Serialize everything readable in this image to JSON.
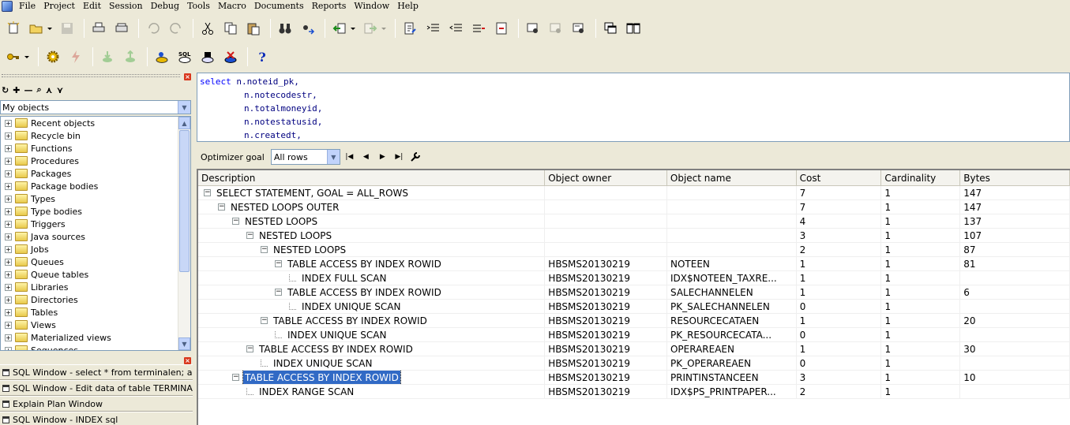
{
  "menu": [
    "File",
    "Project",
    "Edit",
    "Session",
    "Debug",
    "Tools",
    "Macro",
    "Documents",
    "Reports",
    "Window",
    "Help"
  ],
  "toolbar2": {
    "help_label": "?",
    "sql_badge": "SQL"
  },
  "left_panel": {
    "toolbar_glyphs": [
      "↻",
      "✚",
      "—",
      "⌕",
      "⋏",
      "⋎"
    ],
    "close_glyph": "×",
    "filter_value": "My objects",
    "tree_items": [
      "Recent objects",
      "Recycle bin",
      "Functions",
      "Procedures",
      "Packages",
      "Package bodies",
      "Types",
      "Type bodies",
      "Triggers",
      "Java sources",
      "Jobs",
      "Queues",
      "Queue tables",
      "Libraries",
      "Directories",
      "Tables",
      "Views",
      "Materialized views",
      "Sequences"
    ],
    "windows": [
      "SQL Window - select * from terminalen; alter table",
      "SQL Window - Edit data of table TERMINALENG",
      "Explain Plan Window",
      "SQL Window - INDEX sql"
    ]
  },
  "editor": {
    "keyword": "select",
    "lines": [
      "n.noteid_pk,",
      "n.notecodestr,",
      "n.totalmoneyid,",
      "n.notestatusid,",
      "n.createdt,"
    ]
  },
  "optimizer": {
    "label": "Optimizer goal",
    "value": "All rows",
    "nav": [
      "|◀",
      "◀",
      "▶",
      "▶|"
    ]
  },
  "plan": {
    "columns": [
      "Description",
      "Object owner",
      "Object name",
      "Cost",
      "Cardinality",
      "Bytes"
    ],
    "rows": [
      {
        "level": 0,
        "node": "minus",
        "desc": "SELECT STATEMENT, GOAL = ALL_ROWS",
        "owner": "",
        "name": "",
        "cost": "7",
        "card": "1",
        "bytes": "147"
      },
      {
        "level": 1,
        "node": "minus",
        "desc": "NESTED LOOPS OUTER",
        "owner": "",
        "name": "",
        "cost": "7",
        "card": "1",
        "bytes": "147"
      },
      {
        "level": 2,
        "node": "minus",
        "desc": "NESTED LOOPS",
        "owner": "",
        "name": "",
        "cost": "4",
        "card": "1",
        "bytes": "137"
      },
      {
        "level": 3,
        "node": "minus",
        "desc": "NESTED LOOPS",
        "owner": "",
        "name": "",
        "cost": "3",
        "card": "1",
        "bytes": "107"
      },
      {
        "level": 4,
        "node": "minus",
        "desc": "NESTED LOOPS",
        "owner": "",
        "name": "",
        "cost": "2",
        "card": "1",
        "bytes": "87"
      },
      {
        "level": 5,
        "node": "minus",
        "desc": "TABLE ACCESS BY INDEX ROWID",
        "owner": "HBSMS20130219",
        "name": "NOTEEN",
        "cost": "1",
        "card": "1",
        "bytes": "81"
      },
      {
        "level": 6,
        "node": "leaf",
        "desc": "INDEX FULL SCAN",
        "owner": "HBSMS20130219",
        "name": "IDX$NOTEEN_TAXRE...",
        "cost": "1",
        "card": "1",
        "bytes": ""
      },
      {
        "level": 5,
        "node": "minus",
        "desc": "TABLE ACCESS BY INDEX ROWID",
        "owner": "HBSMS20130219",
        "name": "SALECHANNELEN",
        "cost": "1",
        "card": "1",
        "bytes": "6"
      },
      {
        "level": 6,
        "node": "leaf",
        "desc": "INDEX UNIQUE SCAN",
        "owner": "HBSMS20130219",
        "name": "PK_SALECHANNELEN",
        "cost": "0",
        "card": "1",
        "bytes": ""
      },
      {
        "level": 4,
        "node": "minus",
        "desc": "TABLE ACCESS BY INDEX ROWID",
        "owner": "HBSMS20130219",
        "name": "RESOURCECATAEN",
        "cost": "1",
        "card": "1",
        "bytes": "20"
      },
      {
        "level": 5,
        "node": "leaf",
        "desc": "INDEX UNIQUE SCAN",
        "owner": "HBSMS20130219",
        "name": "PK_RESOURCECATA...",
        "cost": "0",
        "card": "1",
        "bytes": ""
      },
      {
        "level": 3,
        "node": "minus",
        "desc": "TABLE ACCESS BY INDEX ROWID",
        "owner": "HBSMS20130219",
        "name": "OPERAREAEN",
        "cost": "1",
        "card": "1",
        "bytes": "30"
      },
      {
        "level": 4,
        "node": "leaf",
        "desc": "INDEX UNIQUE SCAN",
        "owner": "HBSMS20130219",
        "name": "PK_OPERAREAEN",
        "cost": "0",
        "card": "1",
        "bytes": ""
      },
      {
        "level": 2,
        "node": "minus",
        "desc": "TABLE ACCESS BY INDEX ROWID",
        "owner": "HBSMS20130219",
        "name": "PRINTINSTANCEEN",
        "cost": "3",
        "card": "1",
        "bytes": "10",
        "selected": true
      },
      {
        "level": 3,
        "node": "leaf",
        "desc": "INDEX RANGE SCAN",
        "owner": "HBSMS20130219",
        "name": "IDX$PS_PRINTPAPER...",
        "cost": "2",
        "card": "1",
        "bytes": ""
      }
    ]
  }
}
